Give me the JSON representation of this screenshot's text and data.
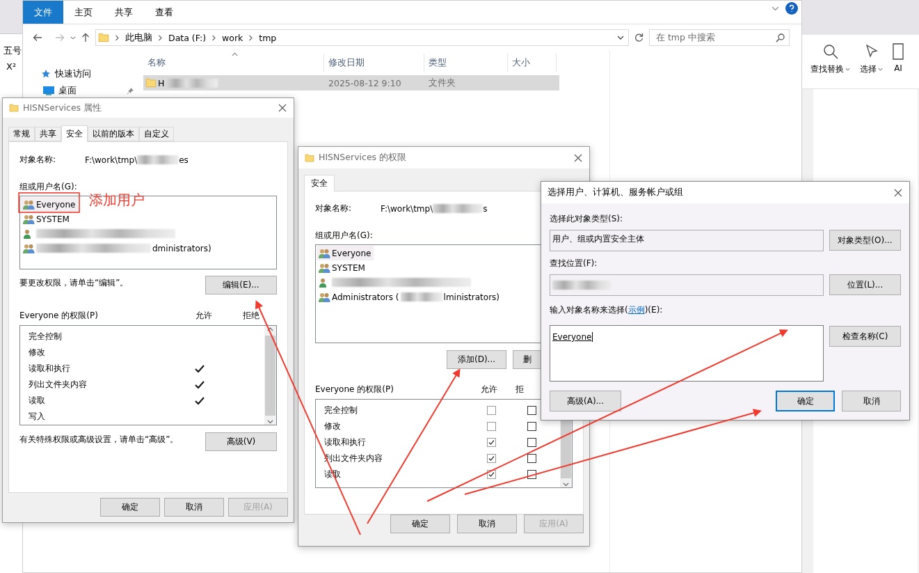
{
  "word_left": {
    "font_size": "五号",
    "superscript": "X²"
  },
  "word_right": {
    "buttons": [
      {
        "label": "查找替换",
        "has_menu": true
      },
      {
        "label": "选择",
        "has_menu": true
      },
      {
        "label": "AI",
        "has_menu": false
      }
    ]
  },
  "explorer": {
    "ribbon_tabs": [
      {
        "label": "文件",
        "selected": true
      },
      {
        "label": "主页",
        "selected": false
      },
      {
        "label": "共享",
        "selected": false
      },
      {
        "label": "查看",
        "selected": false
      }
    ],
    "breadcrumb": [
      "此电脑",
      "Data (F:)",
      "work",
      "tmp"
    ],
    "search": {
      "placeholder": "在 tmp 中搜索"
    },
    "nav": [
      {
        "label": "快速访问",
        "kind": "star",
        "pinned": false
      },
      {
        "label": "桌面",
        "kind": "desktop",
        "pinned": true
      }
    ],
    "columns": [
      "名称",
      "修改日期",
      "类型",
      "大小"
    ],
    "rows": [
      {
        "name": "H",
        "redacted": true,
        "date": "2025-08-12 9:10",
        "type": "文件夹",
        "selected": true
      }
    ]
  },
  "properties_dialog": {
    "title": "HISNServices 属性",
    "tabs": [
      {
        "label": "常规",
        "selected": false
      },
      {
        "label": "共享",
        "selected": false
      },
      {
        "label": "安全",
        "selected": true
      },
      {
        "label": "以前的版本",
        "selected": false
      },
      {
        "label": "自定义",
        "selected": false
      }
    ],
    "object_label": "对象名称:",
    "object_path": "F:\\work\\tmp\\",
    "object_tail": "es",
    "group_label": "组或用户名(G):",
    "users": [
      {
        "name": "Everyone",
        "kind": "group",
        "selected": true,
        "redacted": false
      },
      {
        "name": "SYSTEM",
        "kind": "group",
        "selected": false,
        "redacted": false
      },
      {
        "kind": "user",
        "selected": false,
        "redacted": true
      },
      {
        "kind": "group",
        "selected": false,
        "redacted": true,
        "name_tail": "dministrators)"
      }
    ],
    "edit_hint": "要更改权限，请单击“编辑”。",
    "edit_button": "编辑(E)...",
    "perm_title": "Everyone 的权限(P)",
    "allow_header": "允许",
    "deny_header": "拒绝",
    "permissions": [
      {
        "label": "完全控制",
        "allow": false,
        "deny": false
      },
      {
        "label": "修改",
        "allow": false,
        "deny": false
      },
      {
        "label": "读取和执行",
        "allow": true,
        "deny": false
      },
      {
        "label": "列出文件夹内容",
        "allow": true,
        "deny": false
      },
      {
        "label": "读取",
        "allow": true,
        "deny": false
      },
      {
        "label": "写入",
        "allow": false,
        "deny": false
      }
    ],
    "advanced_hint": "有关特殊权限或高级设置，请单击“高级”。",
    "advanced_button": "高级(V)",
    "buttons": [
      {
        "label": "确定",
        "disabled": false
      },
      {
        "label": "取消",
        "disabled": false
      },
      {
        "label": "应用(A)",
        "disabled": true
      }
    ]
  },
  "annotation": {
    "label": "添加用户"
  },
  "permissions_dialog": {
    "title": "HISNServices 的权限",
    "tabs": [
      {
        "label": "安全",
        "selected": true
      }
    ],
    "object_label": "对象名称:",
    "object_path": "F:\\work\\tmp\\",
    "object_tail": "s",
    "group_label": "组或用户名(G):",
    "users": [
      {
        "name": "Everyone",
        "kind": "group",
        "selected": true,
        "redacted": false
      },
      {
        "name": "SYSTEM",
        "kind": "group",
        "selected": false,
        "redacted": false
      },
      {
        "kind": "user",
        "selected": false,
        "redacted": true
      },
      {
        "name": "Administrators (",
        "kind": "group",
        "selected": false,
        "redacted": true,
        "name_tail": "lministrators)"
      }
    ],
    "add_button": "添加(D)...",
    "remove_button": "删",
    "perm_title": "Everyone 的权限(P)",
    "allow_header": "允许",
    "deny_header": "拒",
    "permissions": [
      {
        "label": "完全控制",
        "allow": false,
        "deny": false
      },
      {
        "label": "修改",
        "allow": false,
        "deny": false
      },
      {
        "label": "读取和执行",
        "allow": true,
        "deny": false
      },
      {
        "label": "列出文件夹内容",
        "allow": true,
        "deny": false
      },
      {
        "label": "读取",
        "allow": true,
        "deny": false
      }
    ],
    "buttons": [
      {
        "label": "确定",
        "disabled": false
      },
      {
        "label": "取消",
        "disabled": false
      },
      {
        "label": "应用(A)",
        "disabled": true
      }
    ]
  },
  "select_dialog": {
    "title": "选择用户、计算机、服务帐户或组",
    "type_label": "选择此对象类型(S):",
    "type_value": "用户、组或内置安全主体",
    "type_button": "对象类型(O)...",
    "location_label": "查找位置(F):",
    "location_redacted": true,
    "location_button": "位置(L)...",
    "names_label_head": "输入对象名称来选择(",
    "names_link": "示例",
    "names_label_tail": ")(E):",
    "names_value": "Everyone",
    "check_button": "检查名称(C)",
    "advanced_button": "高级(A)...",
    "buttons": [
      {
        "label": "确定",
        "default": true
      },
      {
        "label": "取消",
        "default": false
      }
    ]
  }
}
